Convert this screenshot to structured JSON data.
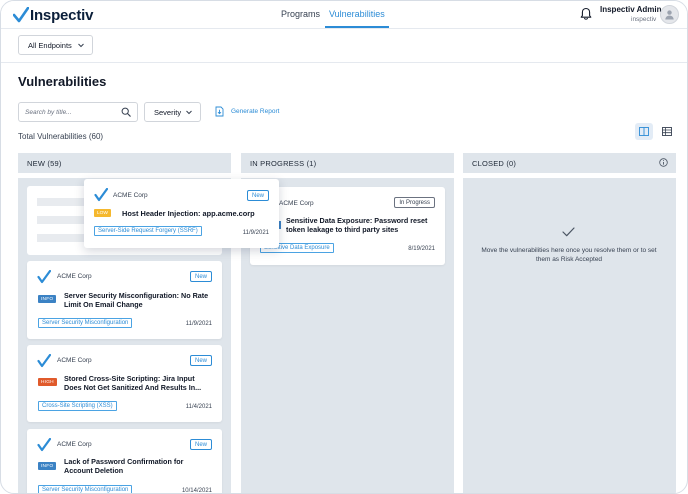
{
  "brand": {
    "name": "Inspectiv"
  },
  "nav": {
    "programs": "Programs",
    "vulnerabilities": "Vulnerabilities"
  },
  "user": {
    "name": "Inspectiv Admin",
    "org": "inspectiv"
  },
  "filters": {
    "endpoints": "All Endpoints",
    "search_placeholder": "Search by title...",
    "severity": "Severity",
    "generate_report": "Generate Report"
  },
  "page": {
    "title": "Vulnerabilities",
    "total": "Total Vulnerabilities (60)"
  },
  "columns": {
    "new": {
      "label": "NEW (59)"
    },
    "in_progress": {
      "label": "IN PROGRESS (1)"
    },
    "closed": {
      "label": "CLOSED (0)",
      "empty_text": "Move the vulnerabilities here once you resolve them or to set them as Risk Accepted"
    }
  },
  "dragged_card": {
    "company": "ACME Corp",
    "status": "New",
    "severity": "LOW",
    "title": "Host Header Injection: app.acme.corp",
    "tag": "Server-Side Request Forgery (SSRF)",
    "date": "11/9/2021"
  },
  "new_cards": [
    {
      "company": "ACME Corp",
      "status": "New",
      "severity": "INFO",
      "title_l1": "Server Security Misconfiguration: No Rate",
      "title_l2": "Limit On Email Change",
      "tag": "Server Security Misconfiguration",
      "date": "11/9/2021"
    },
    {
      "company": "ACME Corp",
      "status": "New",
      "severity": "HIGH",
      "title_l1": "Stored Cross-Site Scripting: Jira Input",
      "title_l2": "Does Not Get Sanitized And Results In...",
      "tag": "Cross-Site Scripting (XSS)",
      "date": "11/4/2021"
    },
    {
      "company": "ACME Corp",
      "status": "New",
      "severity": "INFO",
      "title_l1": "Lack of Password Confirmation for",
      "title_l2": "Account Deletion",
      "tag": "Server Security Misconfiguration",
      "date": "10/14/2021"
    }
  ],
  "progress_card": {
    "company": "ACME Corp",
    "status": "In Progress",
    "title_l1": "Sensitive Data Exposure: Password reset",
    "title_l2": "token leakage to third party sites",
    "tag": "Sensitive Data Exposure",
    "date": "8/19/2021"
  },
  "colors": {
    "accent": "#2c8cd6",
    "column_bg": "#dfe5eb",
    "info": "#3b82c4",
    "high": "#e05a2b",
    "low": "#f5b82e"
  }
}
